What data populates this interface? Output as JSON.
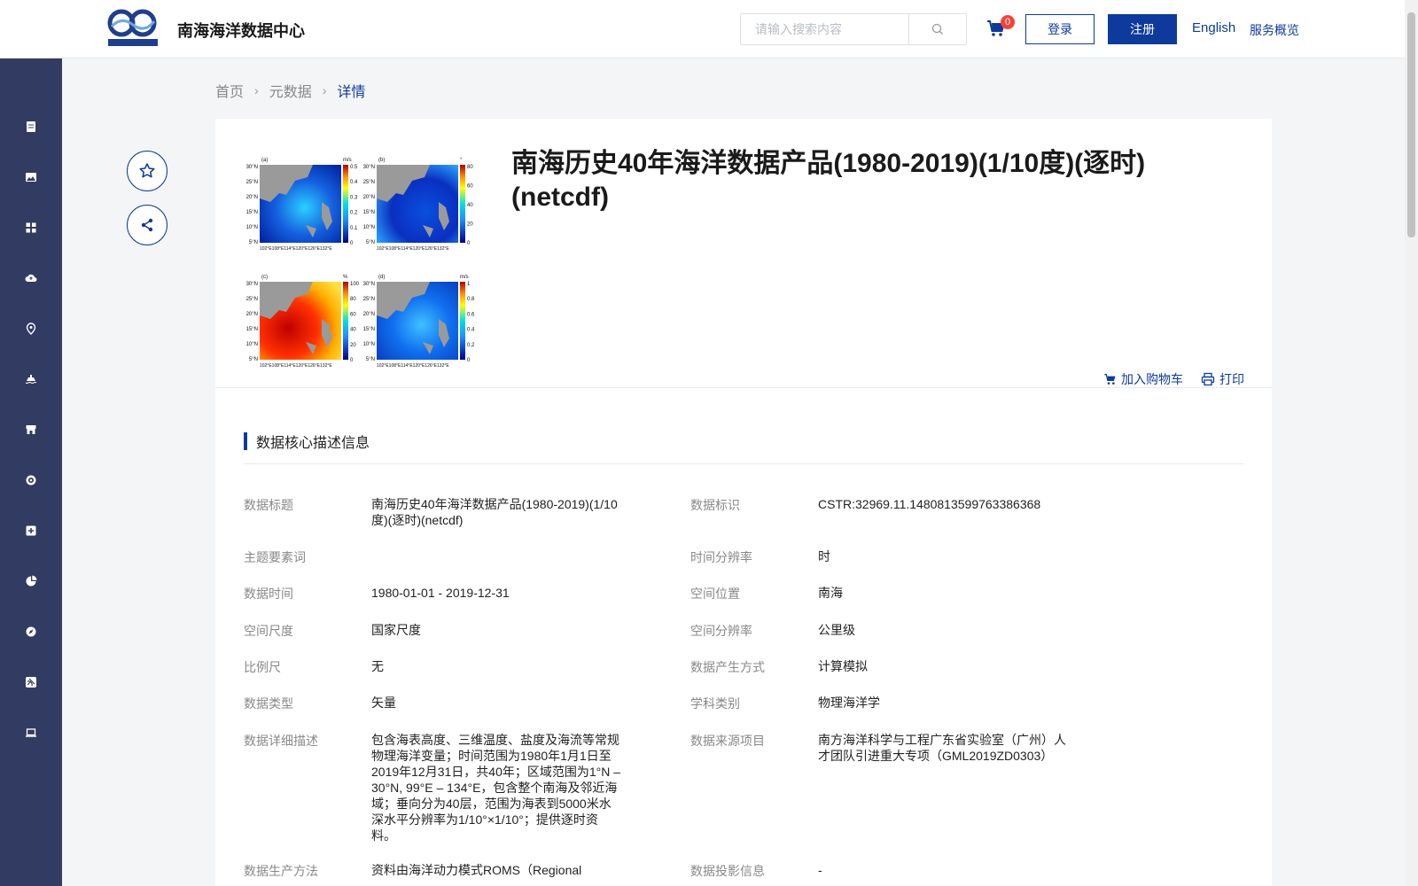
{
  "header": {
    "site_title": "南海海洋数据中心",
    "search_placeholder": "请输入搜索内容",
    "cart_count": "0",
    "login_label": "登录",
    "register_label": "注册",
    "language_label": "English",
    "overview_label": "服务概览",
    "brand_color": "#0d3a9b"
  },
  "sidebar": {
    "items": [
      {
        "icon": "document-icon"
      },
      {
        "icon": "image-icon"
      },
      {
        "icon": "grid-icon"
      },
      {
        "icon": "cloud-upload-icon"
      },
      {
        "icon": "location-pin-icon"
      },
      {
        "icon": "ship-icon"
      },
      {
        "icon": "shop-icon"
      },
      {
        "icon": "target-icon"
      },
      {
        "icon": "medical-box-icon"
      },
      {
        "icon": "pie-chart-icon"
      },
      {
        "icon": "compass-icon"
      },
      {
        "icon": "satellite-icon"
      },
      {
        "icon": "laptop-icon"
      }
    ],
    "background": "#323b61"
  },
  "breadcrumb": {
    "home": "首页",
    "metadata": "元数据",
    "current": "详情"
  },
  "dataset": {
    "title": "南海历史40年海洋数据产品(1980-2019)(1/10度)(逐时)(netcdf)",
    "add_to_cart": "加入购物车",
    "print": "打印"
  },
  "section": {
    "title": "数据核心描述信息"
  },
  "fields": {
    "data_title_label": "数据标题",
    "data_title_value": "南海历史40年海洋数据产品(1980-2019)(1/10度)(逐时)(netcdf)",
    "data_id_label": "数据标识",
    "data_id_value": "CSTR:32969.11.1480813599763386368",
    "keywords_label": "主题要素词",
    "keywords_value": "",
    "time_res_label": "时间分辨率",
    "time_res_value": "时",
    "data_time_label": "数据时间",
    "data_time_value": "1980-01-01 - 2019-12-31",
    "spatial_loc_label": "空间位置",
    "spatial_loc_value": "南海",
    "spatial_scale_label": "空间尺度",
    "spatial_scale_value": "国家尺度",
    "spatial_res_label": "空间分辨率",
    "spatial_res_value": "公里级",
    "scale_label": "比例尺",
    "scale_value": "无",
    "gen_method_label": "数据产生方式",
    "gen_method_value": "计算模拟",
    "data_type_label": "数据类型",
    "data_type_value": "矢量",
    "discipline_label": "学科类别",
    "discipline_value": "物理海洋学",
    "description_label": "数据详细描述",
    "description_value": "包含海表高度、三维温度、盐度及海流等常规物理海洋变量；时间范围为1980年1月1日至2019年12月31日，共40年；区域范围为1°N – 30°N, 99°E – 134°E，包含整个南海及邻近海域；垂向分为40层，范围为海表到5000米水深水平分辨率为1/10°×1/10°；提供逐时资料。",
    "source_label": "数据来源项目",
    "source_value": "南方海洋科学与工程广东省实验室（广州）人才团队引进重大专项（GML2019ZD0303）",
    "production_label": "数据生产方法",
    "production_value": "资料由海洋动力模式ROMS（Regional",
    "projection_label": "数据投影信息",
    "projection_value": "-"
  },
  "thumbnail": {
    "panels": [
      {
        "letter": "(a)",
        "unit": "m/s",
        "ticks": [
          "0.5",
          "0.4",
          "0.3",
          "0.2",
          "0.1",
          "0"
        ]
      },
      {
        "letter": "(b)",
        "unit": "°",
        "ticks": [
          "80",
          "60",
          "40",
          "20",
          "0"
        ]
      },
      {
        "letter": "(c)",
        "unit": "%",
        "ticks": [
          "100",
          "80",
          "60",
          "40",
          "20",
          "0"
        ]
      },
      {
        "letter": "(d)",
        "unit": "m/s",
        "ticks": [
          "1",
          "0.8",
          "0.6",
          "0.4",
          "0.2",
          "0"
        ]
      }
    ],
    "lat_ticks": [
      "30°N",
      "25°N",
      "20°N",
      "15°N",
      "10°N",
      "5°N"
    ],
    "lon_ticks": "102°E108°E114°E120°E126°E132°E"
  }
}
